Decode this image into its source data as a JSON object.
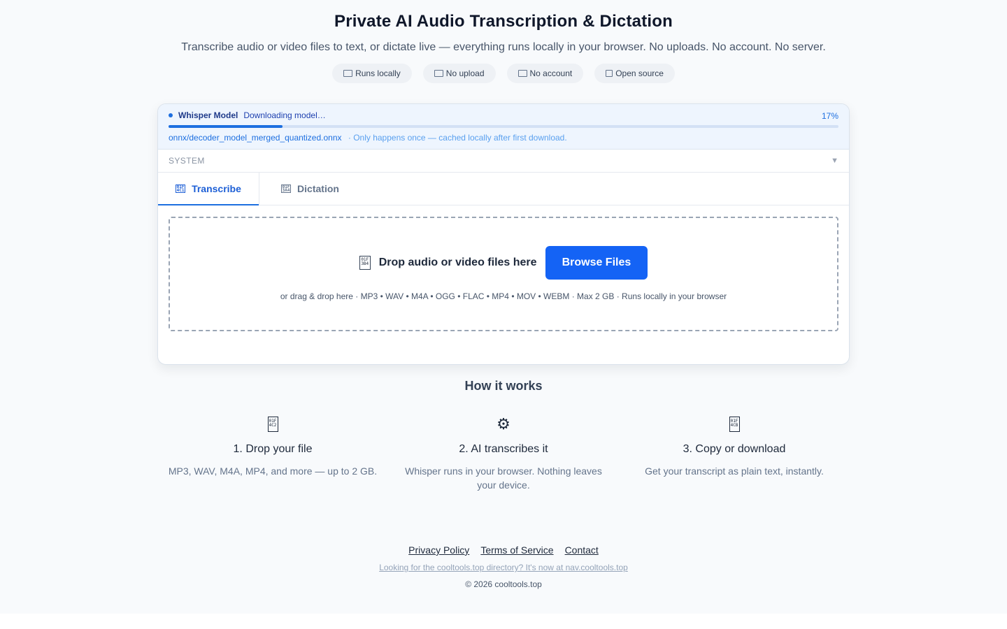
{
  "hero": {
    "title": "Private AI Audio Transcription & Dictation",
    "subtitle": "Transcribe audio or video files to text, or dictate live — everything runs locally in your browser. No uploads. No account. No server.",
    "badges": [
      {
        "label": "Runs locally",
        "icon": "screen-icon"
      },
      {
        "label": "No upload",
        "icon": "screen-icon"
      },
      {
        "label": "No account",
        "icon": "screen-icon"
      },
      {
        "label": "Open source",
        "icon": "box-icon"
      }
    ]
  },
  "model": {
    "name": "Whisper Model",
    "status": "Downloading model…",
    "percent_label": "17%",
    "progress": 0.17,
    "file": "onnx/decoder_model_merged_quantized.onnx",
    "note": "· Only happens once — cached locally after first download.",
    "accent": "#1d6fe0"
  },
  "system": {
    "label": "SYSTEM",
    "toggle": "▼"
  },
  "tabs": [
    {
      "label": "Transcribe",
      "icon": "file-icon",
      "active": true
    },
    {
      "label": "Dictation",
      "icon": "mic-icon",
      "active": false
    }
  ],
  "dropzone": {
    "title": "Drop audio or video files here",
    "browse_label": "Browse Files",
    "meta": "or drag & drop here  ·  MP3 • WAV • M4A • OGG • FLAC • MP4 • MOV • WEBM  ·  Max 2 GB  ·  Runs locally in your browser",
    "button_color": "#1463f5"
  },
  "how": {
    "title": "How it works",
    "steps": [
      {
        "title": "1. Drop your file",
        "desc": "MP3, WAV, M4A, MP4, and more — up to 2 GB.",
        "icon": "file-icon"
      },
      {
        "title": "2. AI transcribes it",
        "desc": "Whisper runs in your browser. Nothing leaves your device.",
        "icon": "gear-icon"
      },
      {
        "title": "3. Copy or download",
        "desc": "Get your transcript as plain text, instantly.",
        "icon": "file-icon"
      }
    ]
  },
  "footer": {
    "links": [
      "Privacy Policy",
      "Terms of Service",
      "Contact"
    ],
    "directory": "Looking for the cooltools.top directory? It's now at nav.cooltools.top",
    "copyright": "© 2026 cooltools.top"
  }
}
